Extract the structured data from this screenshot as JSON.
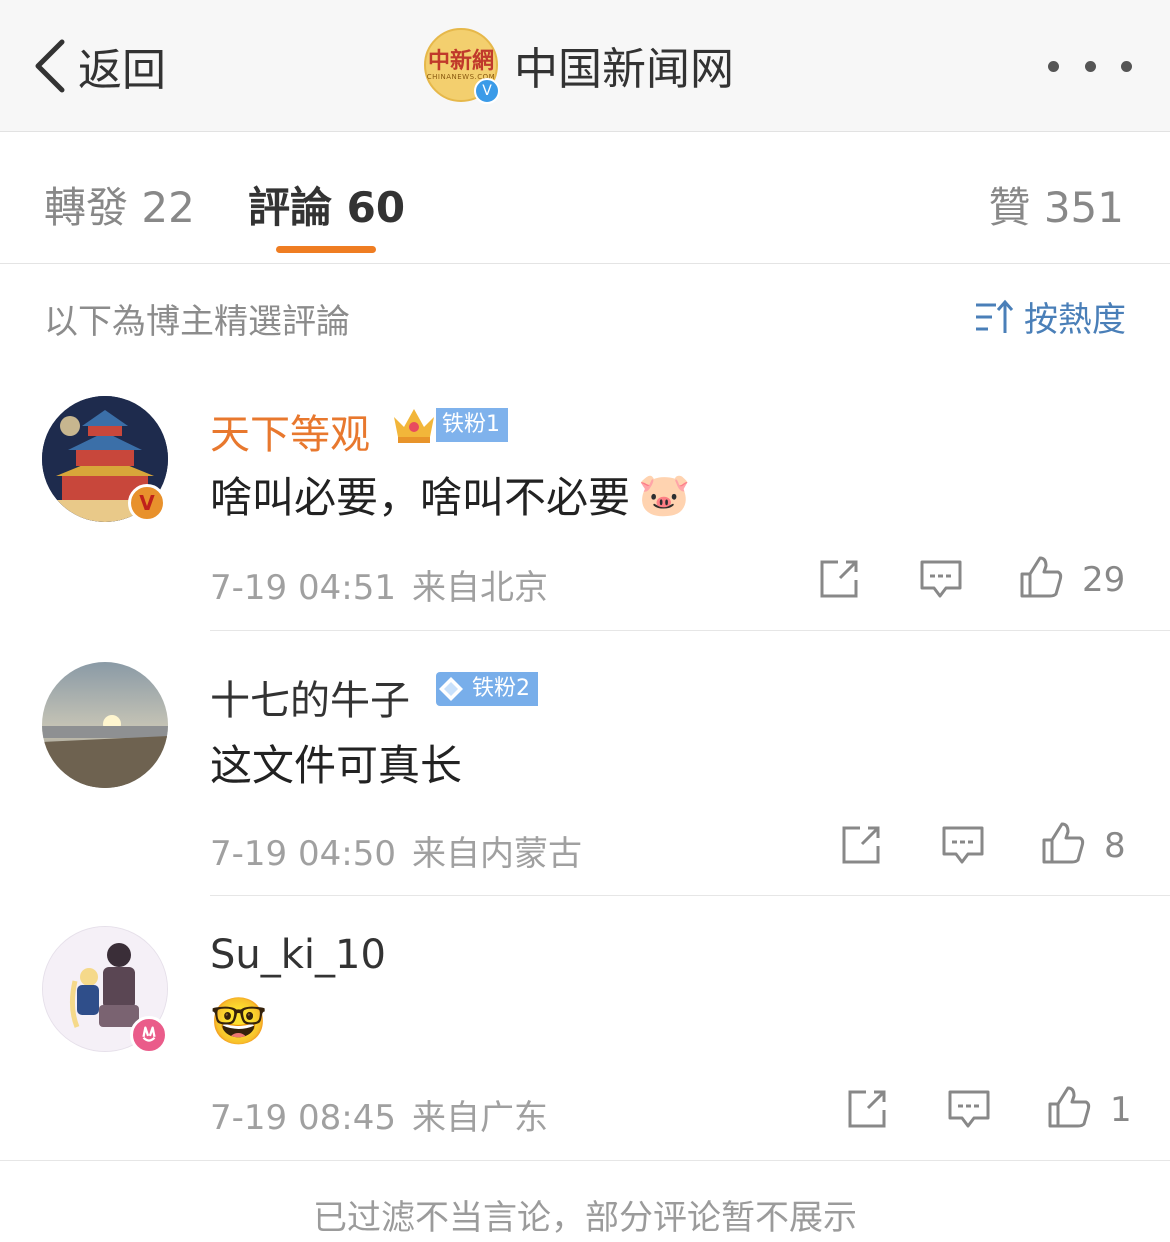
{
  "header": {
    "back_label": "返回",
    "account_name": "中国新闻网",
    "logo_text": "中新網",
    "logo_subtext": "CHINANEWS.COM",
    "verified_mark": "V"
  },
  "tabs": {
    "repost": "轉發 22",
    "comment": "評論 60",
    "like": "贊 351"
  },
  "filter": {
    "note": "以下為博主精選評論",
    "sort_label": "按熱度"
  },
  "comments": [
    {
      "username": "天下等观",
      "name_color": "#e8782e",
      "badge": "铁粉1",
      "badge_color": "#7fb2ec",
      "text": "啥叫必要，啥叫不必要",
      "emoji": "🐷",
      "date": "7-19 04:51",
      "location": "来自北京",
      "likes": "29",
      "avatar_badge": "V"
    },
    {
      "username": "十七的牛子",
      "name_color": "#333333",
      "badge": "铁粉2",
      "badge_color": "#78aeea",
      "text": "这文件可真长",
      "date": "7-19 04:50",
      "location": "来自内蒙古",
      "likes": "8"
    },
    {
      "username": "Su_ki_10",
      "name_color": "#333333",
      "emoji": "🤓",
      "date": "7-19 08:45",
      "location": "来自广东",
      "likes": "1"
    }
  ],
  "footer": {
    "note": "已过滤不当言论，部分评论暂不展示"
  }
}
